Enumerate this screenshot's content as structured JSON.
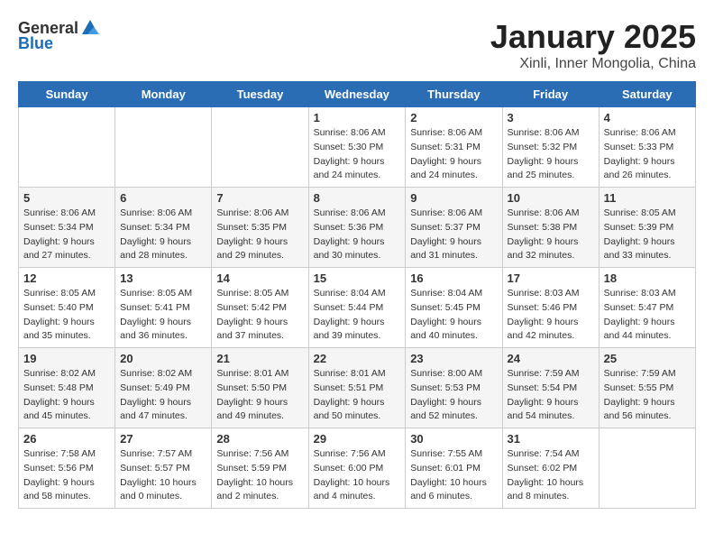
{
  "header": {
    "logo_general": "General",
    "logo_blue": "Blue",
    "month": "January 2025",
    "location": "Xinli, Inner Mongolia, China"
  },
  "weekdays": [
    "Sunday",
    "Monday",
    "Tuesday",
    "Wednesday",
    "Thursday",
    "Friday",
    "Saturday"
  ],
  "weeks": [
    [
      {
        "day": "",
        "info": ""
      },
      {
        "day": "",
        "info": ""
      },
      {
        "day": "",
        "info": ""
      },
      {
        "day": "1",
        "info": "Sunrise: 8:06 AM\nSunset: 5:30 PM\nDaylight: 9 hours\nand 24 minutes."
      },
      {
        "day": "2",
        "info": "Sunrise: 8:06 AM\nSunset: 5:31 PM\nDaylight: 9 hours\nand 24 minutes."
      },
      {
        "day": "3",
        "info": "Sunrise: 8:06 AM\nSunset: 5:32 PM\nDaylight: 9 hours\nand 25 minutes."
      },
      {
        "day": "4",
        "info": "Sunrise: 8:06 AM\nSunset: 5:33 PM\nDaylight: 9 hours\nand 26 minutes."
      }
    ],
    [
      {
        "day": "5",
        "info": "Sunrise: 8:06 AM\nSunset: 5:34 PM\nDaylight: 9 hours\nand 27 minutes."
      },
      {
        "day": "6",
        "info": "Sunrise: 8:06 AM\nSunset: 5:34 PM\nDaylight: 9 hours\nand 28 minutes."
      },
      {
        "day": "7",
        "info": "Sunrise: 8:06 AM\nSunset: 5:35 PM\nDaylight: 9 hours\nand 29 minutes."
      },
      {
        "day": "8",
        "info": "Sunrise: 8:06 AM\nSunset: 5:36 PM\nDaylight: 9 hours\nand 30 minutes."
      },
      {
        "day": "9",
        "info": "Sunrise: 8:06 AM\nSunset: 5:37 PM\nDaylight: 9 hours\nand 31 minutes."
      },
      {
        "day": "10",
        "info": "Sunrise: 8:06 AM\nSunset: 5:38 PM\nDaylight: 9 hours\nand 32 minutes."
      },
      {
        "day": "11",
        "info": "Sunrise: 8:05 AM\nSunset: 5:39 PM\nDaylight: 9 hours\nand 33 minutes."
      }
    ],
    [
      {
        "day": "12",
        "info": "Sunrise: 8:05 AM\nSunset: 5:40 PM\nDaylight: 9 hours\nand 35 minutes."
      },
      {
        "day": "13",
        "info": "Sunrise: 8:05 AM\nSunset: 5:41 PM\nDaylight: 9 hours\nand 36 minutes."
      },
      {
        "day": "14",
        "info": "Sunrise: 8:05 AM\nSunset: 5:42 PM\nDaylight: 9 hours\nand 37 minutes."
      },
      {
        "day": "15",
        "info": "Sunrise: 8:04 AM\nSunset: 5:44 PM\nDaylight: 9 hours\nand 39 minutes."
      },
      {
        "day": "16",
        "info": "Sunrise: 8:04 AM\nSunset: 5:45 PM\nDaylight: 9 hours\nand 40 minutes."
      },
      {
        "day": "17",
        "info": "Sunrise: 8:03 AM\nSunset: 5:46 PM\nDaylight: 9 hours\nand 42 minutes."
      },
      {
        "day": "18",
        "info": "Sunrise: 8:03 AM\nSunset: 5:47 PM\nDaylight: 9 hours\nand 44 minutes."
      }
    ],
    [
      {
        "day": "19",
        "info": "Sunrise: 8:02 AM\nSunset: 5:48 PM\nDaylight: 9 hours\nand 45 minutes."
      },
      {
        "day": "20",
        "info": "Sunrise: 8:02 AM\nSunset: 5:49 PM\nDaylight: 9 hours\nand 47 minutes."
      },
      {
        "day": "21",
        "info": "Sunrise: 8:01 AM\nSunset: 5:50 PM\nDaylight: 9 hours\nand 49 minutes."
      },
      {
        "day": "22",
        "info": "Sunrise: 8:01 AM\nSunset: 5:51 PM\nDaylight: 9 hours\nand 50 minutes."
      },
      {
        "day": "23",
        "info": "Sunrise: 8:00 AM\nSunset: 5:53 PM\nDaylight: 9 hours\nand 52 minutes."
      },
      {
        "day": "24",
        "info": "Sunrise: 7:59 AM\nSunset: 5:54 PM\nDaylight: 9 hours\nand 54 minutes."
      },
      {
        "day": "25",
        "info": "Sunrise: 7:59 AM\nSunset: 5:55 PM\nDaylight: 9 hours\nand 56 minutes."
      }
    ],
    [
      {
        "day": "26",
        "info": "Sunrise: 7:58 AM\nSunset: 5:56 PM\nDaylight: 9 hours\nand 58 minutes."
      },
      {
        "day": "27",
        "info": "Sunrise: 7:57 AM\nSunset: 5:57 PM\nDaylight: 10 hours\nand 0 minutes."
      },
      {
        "day": "28",
        "info": "Sunrise: 7:56 AM\nSunset: 5:59 PM\nDaylight: 10 hours\nand 2 minutes."
      },
      {
        "day": "29",
        "info": "Sunrise: 7:56 AM\nSunset: 6:00 PM\nDaylight: 10 hours\nand 4 minutes."
      },
      {
        "day": "30",
        "info": "Sunrise: 7:55 AM\nSunset: 6:01 PM\nDaylight: 10 hours\nand 6 minutes."
      },
      {
        "day": "31",
        "info": "Sunrise: 7:54 AM\nSunset: 6:02 PM\nDaylight: 10 hours\nand 8 minutes."
      },
      {
        "day": "",
        "info": ""
      }
    ]
  ]
}
